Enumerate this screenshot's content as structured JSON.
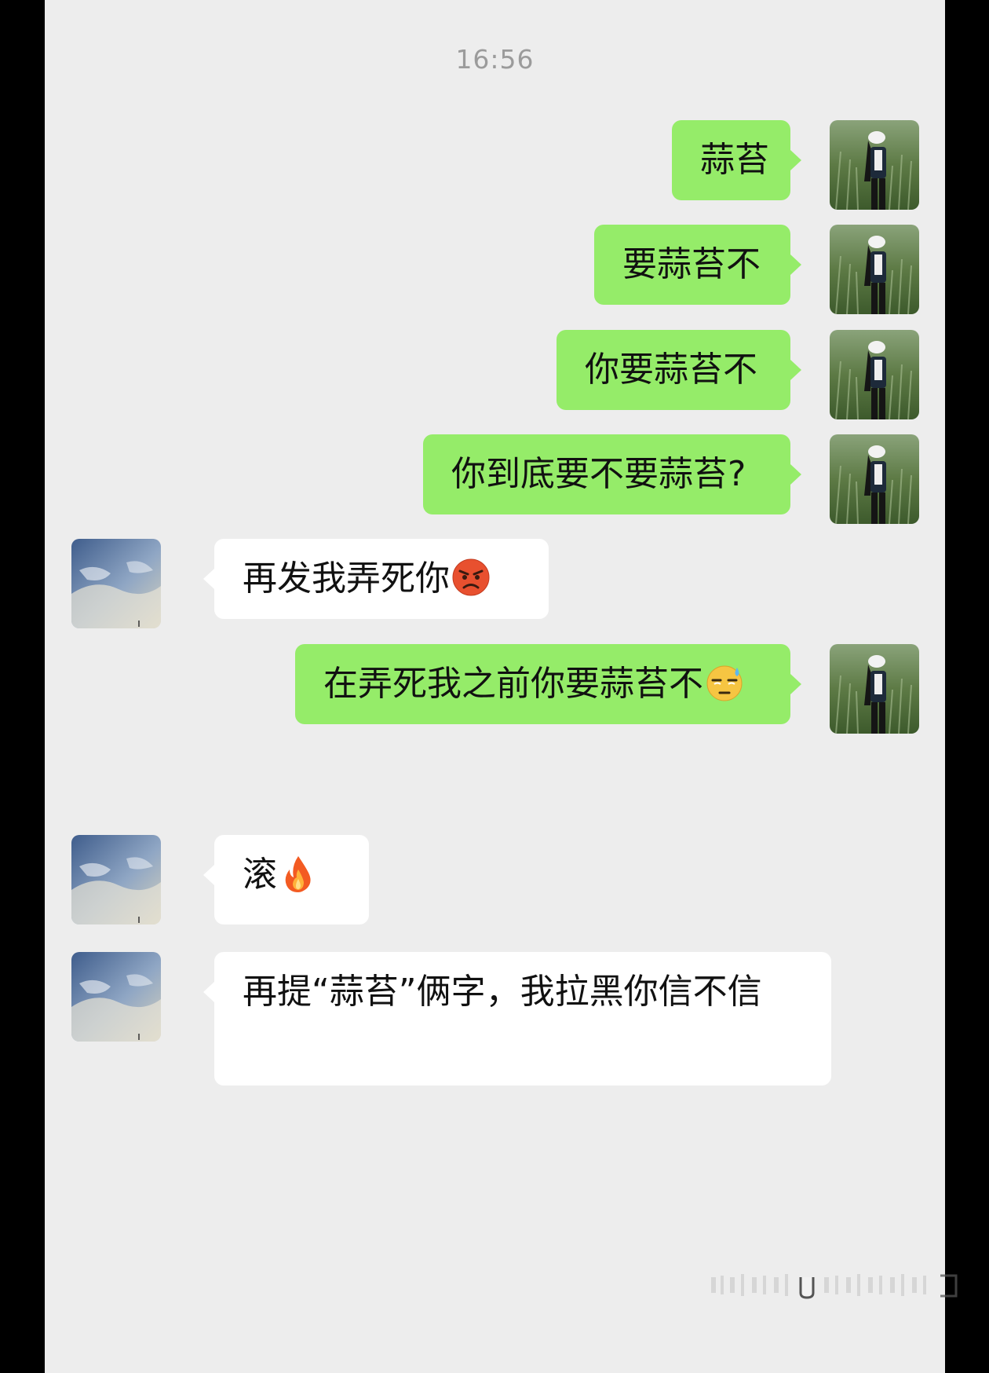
{
  "chat": {
    "timestamp": "16:56",
    "messages": [
      {
        "side": "out",
        "text": "蒜苔"
      },
      {
        "side": "out",
        "text": "要蒜苔不"
      },
      {
        "side": "out",
        "text": "你要蒜苔不"
      },
      {
        "side": "out",
        "text": "你到底要不要蒜苔?"
      },
      {
        "side": "in",
        "text": "再发我弄死你",
        "emoji": "angry-face-emoji"
      },
      {
        "side": "out",
        "text": "在弄死我之前你要蒜苔不",
        "emoji": "sweat-face-emoji"
      },
      {
        "side": "in",
        "text": "滚",
        "emoji": "fire-emoji"
      },
      {
        "side": "in",
        "text": "再提“蒜苔”俩字，我拉黑你信不信"
      }
    ]
  },
  "colors": {
    "background": "#ededed",
    "outgoing_bubble": "#95ec69",
    "incoming_bubble": "#ffffff",
    "timestamp_text": "#9b9b9b"
  },
  "avatars": {
    "self": "girl-in-field-avatar",
    "contact": "sky-clouds-avatar"
  }
}
